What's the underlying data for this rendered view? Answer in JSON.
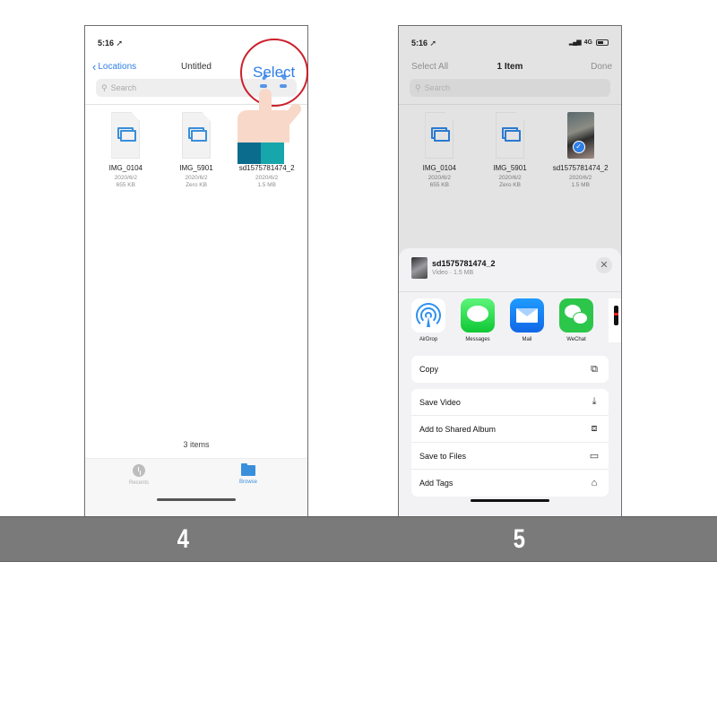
{
  "panels": [
    {
      "step": "4",
      "status": {
        "time": "5:16",
        "location_icon": "location-arrow-icon"
      },
      "nav": {
        "back_label": "Locations",
        "title": "Untitled",
        "action": "Select"
      },
      "search": {
        "placeholder": "Search"
      },
      "files": [
        {
          "name": "IMG_0104",
          "date": "2020/6/2",
          "size": "655 KB",
          "type": "document"
        },
        {
          "name": "IMG_5901",
          "date": "2020/6/2",
          "size": "Zero KB",
          "type": "document"
        },
        {
          "name": "sd1575781474_2",
          "date": "2020/6/2",
          "size": "1.5 MB",
          "type": "video"
        }
      ],
      "items_count": "3 items",
      "tabs": [
        {
          "label": "Recents",
          "icon": "clock-icon",
          "active": false
        },
        {
          "label": "Browse",
          "icon": "folder-icon",
          "active": true
        }
      ],
      "overlay": {
        "tap_target": "Select",
        "hint": "tap-hand-icon"
      }
    },
    {
      "step": "5",
      "status": {
        "time": "5:16",
        "network": "4G",
        "location_icon": "location-arrow-icon"
      },
      "nav": {
        "left": "Select All",
        "title": "1 Item",
        "right": "Done"
      },
      "search": {
        "placeholder": "Search"
      },
      "files": [
        {
          "name": "IMG_0104",
          "date": "2020/6/2",
          "size": "655 KB",
          "type": "document",
          "selected": false
        },
        {
          "name": "IMG_5901",
          "date": "2020/6/2",
          "size": "Zero KB",
          "type": "document",
          "selected": false
        },
        {
          "name": "sd1575781474_2",
          "date": "2020/6/2",
          "size": "1.5 MB",
          "type": "video",
          "selected": true
        }
      ],
      "share_sheet": {
        "title": "sd1575781474_2",
        "subtitle": "Video · 1.5 MB",
        "close_icon": "close-icon",
        "apps": [
          {
            "label": "AirDrop",
            "icon": "airdrop-icon",
            "color": "#2f8ff0"
          },
          {
            "label": "Messages",
            "icon": "messages-icon",
            "color": "#1fd14a"
          },
          {
            "label": "Mail",
            "icon": "mail-icon",
            "color": "#1a84f5"
          },
          {
            "label": "WeChat",
            "icon": "wechat-icon",
            "color": "#2cc64b"
          }
        ],
        "actions": [
          [
            {
              "label": "Copy",
              "icon": "copy-icon"
            }
          ],
          [
            {
              "label": "Save Video",
              "icon": "save-download-icon"
            },
            {
              "label": "Add to Shared Album",
              "icon": "shared-album-icon"
            },
            {
              "label": "Save to Files",
              "icon": "folder-icon"
            },
            {
              "label": "Add Tags",
              "icon": "tag-icon"
            }
          ]
        ]
      }
    }
  ],
  "colors": {
    "accent": "#2f7ee6",
    "tap_ring": "#cc1f2b",
    "band": "#7a7a7a"
  }
}
